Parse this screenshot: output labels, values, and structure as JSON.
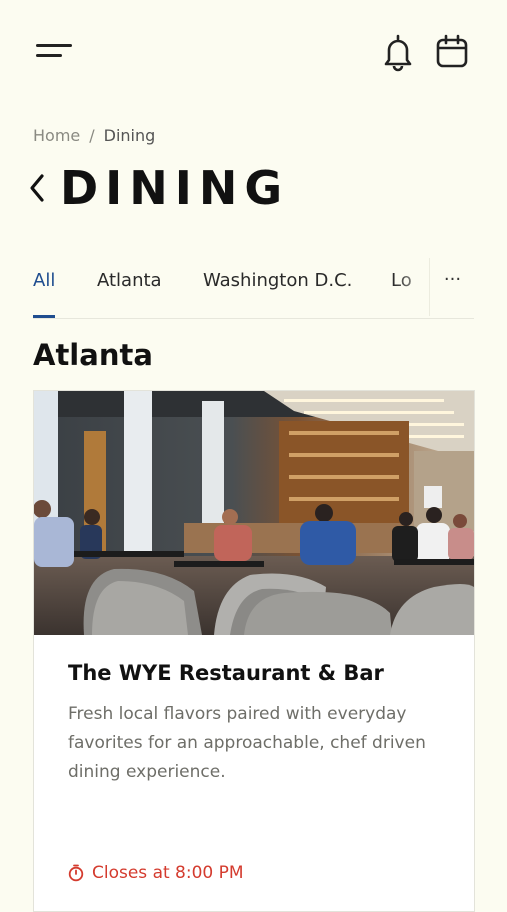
{
  "header": {
    "menu_icon": "hamburger-menu-icon",
    "notifications_icon": "bell-icon",
    "calendar_icon": "calendar-icon"
  },
  "breadcrumb": {
    "home": "Home",
    "separator": "/",
    "current": "Dining"
  },
  "page": {
    "back_icon": "chevron-left-icon",
    "title": "DINING"
  },
  "tabs": {
    "items": [
      {
        "label": "All",
        "active": true
      },
      {
        "label": "Atlanta",
        "active": false
      },
      {
        "label": "Washington D.C.",
        "active": false
      },
      {
        "label": "Lo",
        "active": false
      }
    ],
    "more_label": "···",
    "active_color": "#1f4d8f"
  },
  "section": {
    "heading": "Atlanta"
  },
  "cards": [
    {
      "name": "The WYE Restaurant & Bar",
      "description": "Fresh local flavors paired with everyday favorites for an approachable, chef driven dining experience.",
      "status_icon": "clock-icon",
      "status": "Closes at 8:00 PM",
      "status_color": "#d43b2e"
    }
  ],
  "colors": {
    "background": "#fcfcf1",
    "accent": "#1f4d8f"
  }
}
